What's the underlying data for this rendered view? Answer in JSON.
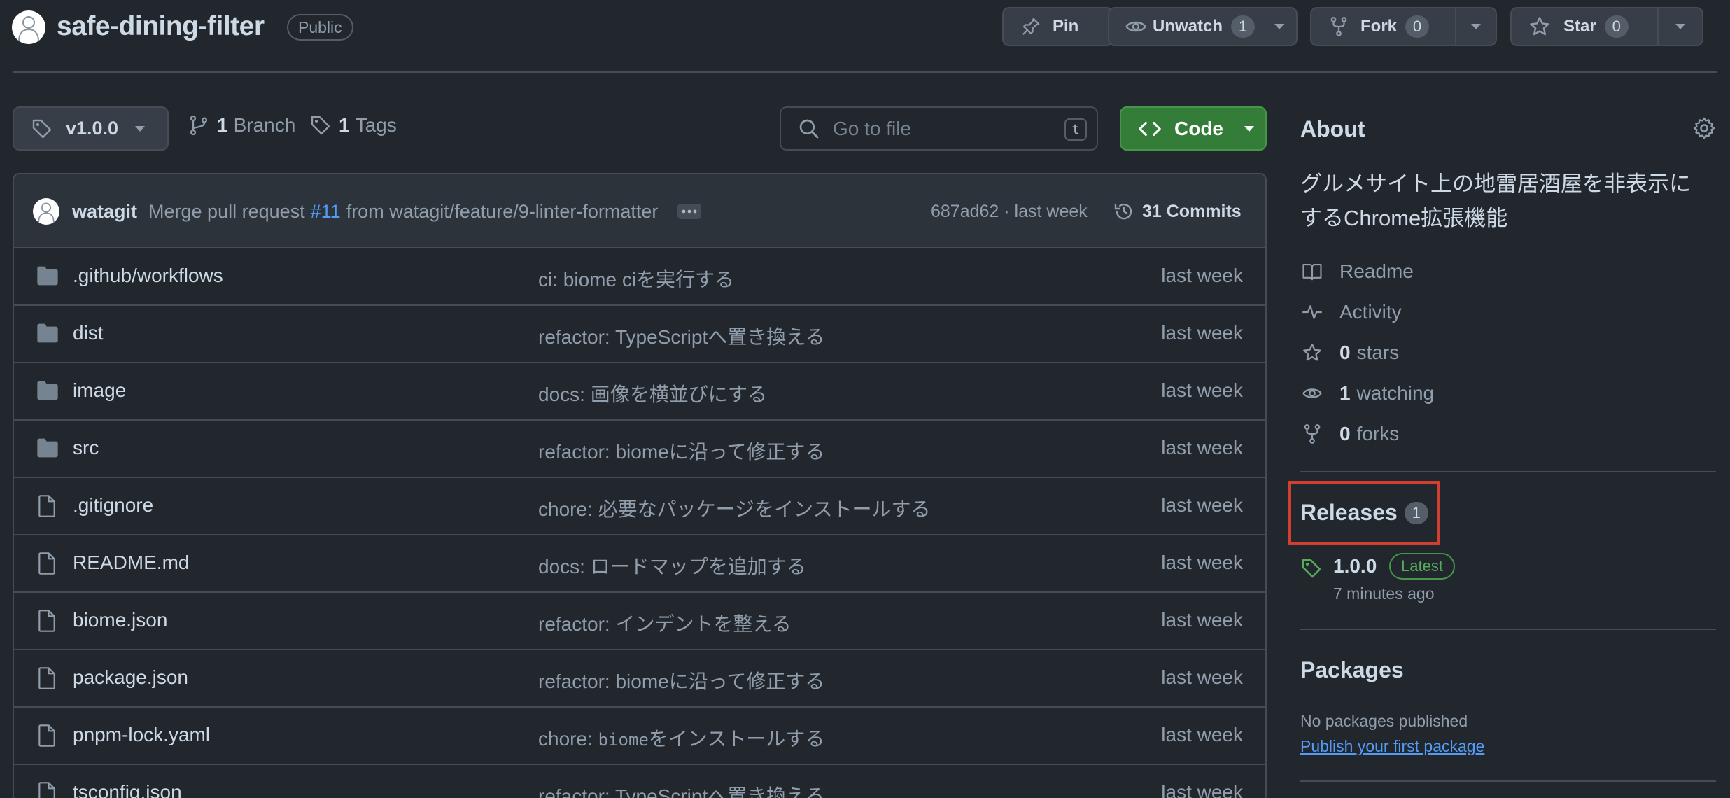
{
  "repo": {
    "name": "safe-dining-filter",
    "visibility": "Public"
  },
  "actions": {
    "pin_label": "Pin",
    "unwatch_label": "Unwatch",
    "unwatch_count": "1",
    "fork_label": "Fork",
    "fork_count": "0",
    "star_label": "Star",
    "star_count": "0"
  },
  "toolbar": {
    "tag": "v1.0.0",
    "branch_count": "1",
    "branch_label": "Branch",
    "tags_count": "1",
    "tags_label": "Tags",
    "search_placeholder": "Go to file",
    "search_shortcut": "t",
    "code_label": "Code"
  },
  "latest_commit": {
    "author": "watagit",
    "message_prefix": "Merge pull request",
    "pr": "#11",
    "message_suffix": "from watagit/feature/9-linter-formatter",
    "hash_time": "687ad62 · last week",
    "commits": "31 Commits"
  },
  "files": [
    {
      "type": "dir",
      "name": ".github/workflows",
      "message": "ci: biome ciを実行する",
      "time": "last week"
    },
    {
      "type": "dir",
      "name": "dist",
      "message": "refactor: TypeScriptへ置き換える",
      "time": "last week"
    },
    {
      "type": "dir",
      "name": "image",
      "message": "docs: 画像を横並びにする",
      "time": "last week"
    },
    {
      "type": "dir",
      "name": "src",
      "message": "refactor: biomeに沿って修正する",
      "time": "last week"
    },
    {
      "type": "file",
      "name": ".gitignore",
      "message": "chore: 必要なパッケージをインストールする",
      "time": "last week"
    },
    {
      "type": "file",
      "name": "README.md",
      "message": "docs: ロードマップを追加する",
      "time": "last week"
    },
    {
      "type": "file",
      "name": "biome.json",
      "message": "refactor: インデントを整える",
      "time": "last week"
    },
    {
      "type": "file",
      "name": "package.json",
      "message": "refactor: biomeに沿って修正する",
      "time": "last week"
    },
    {
      "type": "file",
      "name": "pnpm-lock.yaml",
      "message_prefix": "chore: ",
      "message_code": "biome",
      "message_suffix": "をインストールする",
      "time": "last week"
    },
    {
      "type": "file",
      "name": "tsconfig.json",
      "message": "refactor: TypeScriptへ置き換える",
      "time": "last week"
    }
  ],
  "about": {
    "title": "About",
    "description": "グルメサイト上の地雷居酒屋を非表示にするChrome拡張機能",
    "readme": "Readme",
    "activity": "Activity",
    "stars_count": "0",
    "stars_label": "stars",
    "watching_count": "1",
    "watching_label": "watching",
    "forks_count": "0",
    "forks_label": "forks"
  },
  "releases": {
    "title": "Releases",
    "count": "1",
    "latest_version": "1.0.0",
    "latest_badge": "Latest",
    "latest_time": "7 minutes ago"
  },
  "packages": {
    "title": "Packages",
    "empty_text": "No packages published",
    "publish_link": "Publish your first package"
  },
  "colors": {
    "background": "#22272e",
    "code_button": "#347d39",
    "link": "#539bf5",
    "highlight_box": "#d13f30",
    "latest_green": "#57ab5a"
  }
}
